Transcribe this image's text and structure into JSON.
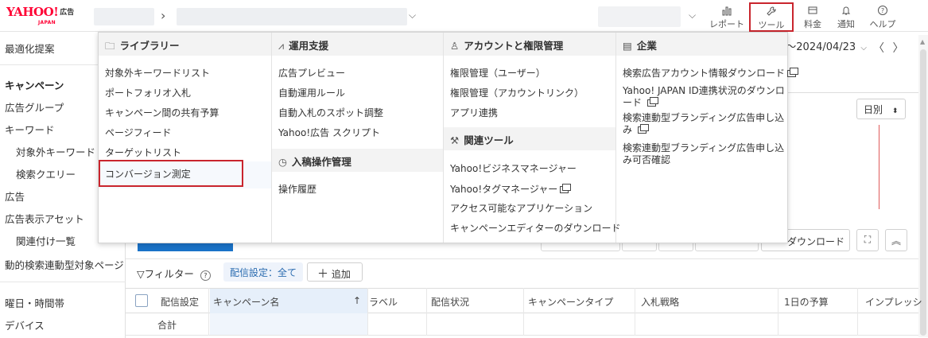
{
  "header": {
    "logo_text": "YAHOO!",
    "logo_sub": "JAPAN",
    "logo_kokoku": "広告",
    "buttons": [
      {
        "label": "レポート",
        "icon": "report-icon"
      },
      {
        "label": "ツール",
        "icon": "wrench-icon"
      },
      {
        "label": "料金",
        "icon": "billing-icon"
      },
      {
        "label": "通知",
        "icon": "bell-icon"
      },
      {
        "label": "ヘルプ",
        "icon": "help-icon"
      }
    ]
  },
  "sidebar": {
    "items": [
      {
        "label": "最適化提案"
      },
      {
        "label": "キャンペーン"
      },
      {
        "label": "広告グループ"
      },
      {
        "label": "キーワード"
      },
      {
        "label": "対象外キーワード"
      },
      {
        "label": "検索クエリー"
      },
      {
        "label": "広告"
      },
      {
        "label": "広告表示アセット"
      },
      {
        "label": "関連付け一覧"
      },
      {
        "label": "動的検索連動型対象ページ"
      },
      {
        "label": "曜日・時間帯"
      },
      {
        "label": "デバイス"
      }
    ]
  },
  "main": {
    "date_range": "7〜2024/04/23",
    "granularity": "日別",
    "download_label": "ダウンロード",
    "filter_label": "フィルター",
    "filter_chip": "配信設定：全て",
    "add_label": "追加",
    "columns": [
      "配信設定",
      "キャンペーン名",
      "ラベル",
      "配信状況",
      "キャンペーンタイプ",
      "入札戦略",
      "1日の予算",
      "インプレッシ"
    ],
    "total_label": "合計"
  },
  "menu": {
    "library": {
      "title": "ライブラリー",
      "items": [
        "対象外キーワードリスト",
        "ポートフォリオ入札",
        "キャンペーン間の共有予算",
        "ページフィード",
        "ターゲットリスト",
        "コンバージョン測定"
      ]
    },
    "operation": {
      "title": "運用支援",
      "items": [
        "広告プレビュー",
        "自動運用ルール",
        "自動入札のスポット調整",
        "Yahoo!広告 スクリプト"
      ]
    },
    "upload": {
      "title": "入稿操作管理",
      "items": [
        "操作履歴"
      ]
    },
    "account": {
      "title": "アカウントと権限管理",
      "items": [
        "権限管理（ユーザー）",
        "権限管理（アカウントリンク）",
        "アプリ連携"
      ]
    },
    "related": {
      "title": "関連ツール",
      "items": [
        "Yahoo!ビジネスマネージャー",
        "Yahoo!タグマネージャー",
        "アクセス可能なアプリケーション",
        "キャンペーンエディターのダウンロード"
      ]
    },
    "company": {
      "title": "企業",
      "items": [
        "検索広告アカウント情報ダウンロード",
        "Yahoo! JAPAN ID連携状況のダウンロード",
        "検索連動型ブランディング広告申し込み",
        "検索連動型ブランディング広告申し込み可否確認"
      ]
    }
  },
  "colors": {
    "accent": "#1a73c8",
    "highlight_border": "#c9252d",
    "brand_red": "#ff0033"
  }
}
